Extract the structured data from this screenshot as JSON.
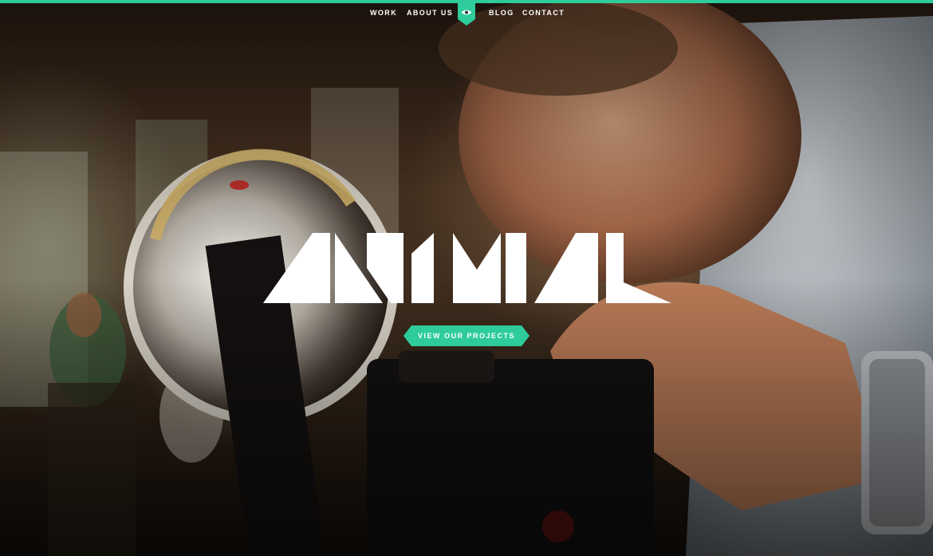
{
  "colors": {
    "accent": "#2ecc9a",
    "nav_text": "#ffffff",
    "logo_fill": "#ffffff"
  },
  "nav": {
    "items": [
      {
        "label": "WORK"
      },
      {
        "label": "ABOUT US"
      },
      {
        "label": "BLOG"
      },
      {
        "label": "CONTACT"
      }
    ],
    "center_icon": "eye-icon"
  },
  "hero": {
    "logo_text": "ANIMAL",
    "cta_label": "VIEW OUR PROJECTS"
  }
}
